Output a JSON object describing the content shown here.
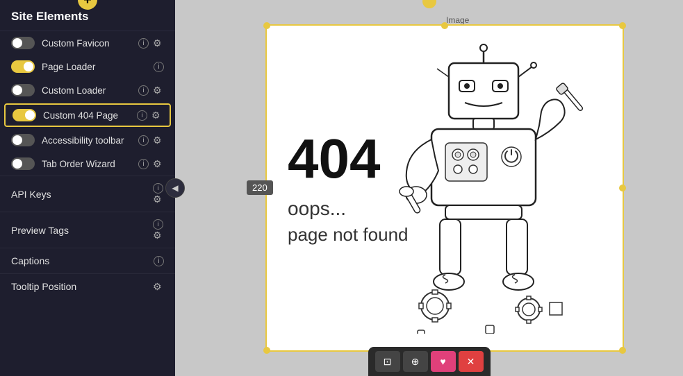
{
  "sidebar": {
    "title": "Site Elements",
    "collapse_icon": "◀",
    "add_icon": "+",
    "items": [
      {
        "id": "custom-favicon",
        "label": "Custom Favicon",
        "toggle_state": "off",
        "has_info": true,
        "has_gear": true
      },
      {
        "id": "page-loader",
        "label": "Page Loader",
        "toggle_state": "on",
        "has_info": true,
        "has_gear": false
      },
      {
        "id": "custom-loader",
        "label": "Custom Loader",
        "toggle_state": "off",
        "has_info": true,
        "has_gear": true
      },
      {
        "id": "custom-404-page",
        "label": "Custom 404 Page",
        "toggle_state": "on",
        "has_info": true,
        "has_gear": true,
        "active": true
      },
      {
        "id": "accessibility-toolbar",
        "label": "Accessibility toolbar",
        "toggle_state": "off",
        "has_info": true,
        "has_gear": true
      },
      {
        "id": "tab-order-wizard",
        "label": "Tab Order Wizard",
        "toggle_state": "off",
        "has_info": true,
        "has_gear": true
      }
    ],
    "menu_items": [
      {
        "id": "api-keys",
        "label": "API Keys",
        "has_info": true,
        "has_gear": true
      },
      {
        "id": "preview-tags",
        "label": "Preview Tags",
        "has_info": true,
        "has_gear": true
      },
      {
        "id": "captions",
        "label": "Captions",
        "has_info": true,
        "has_gear": false
      },
      {
        "id": "tooltip-position",
        "label": "Tooltip Position",
        "has_info": false,
        "has_gear": true
      }
    ]
  },
  "main": {
    "image_label": "Image",
    "badge_value": "220",
    "text_404": "404",
    "text_oops": "oops...",
    "text_not_found": "page not found"
  },
  "toolbar": {
    "buttons": [
      "⊡",
      "⊕",
      "♥",
      "✕"
    ]
  }
}
